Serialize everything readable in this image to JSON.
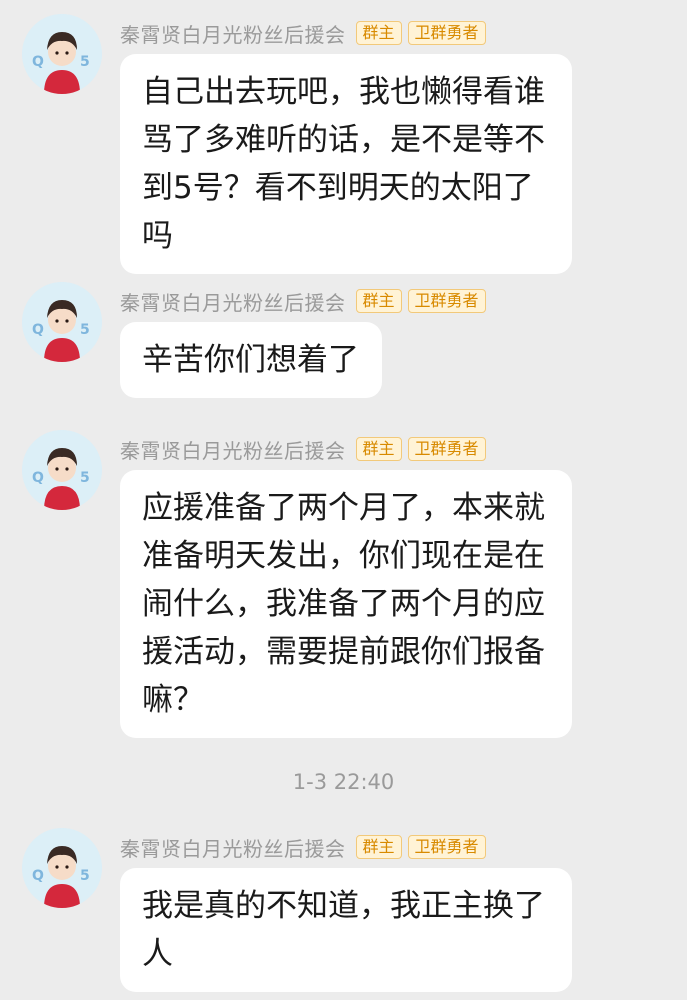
{
  "messages": [
    {
      "sender": "秦霄贤白月光粉丝后援会",
      "badges": [
        "群主",
        "卫群勇者"
      ],
      "lines": [
        "自己出去玩吧，我也懒得看谁",
        "骂了多难听的话，是不是等不",
        "到5号？看不到明天的太阳了",
        "吗"
      ]
    },
    {
      "sender": "秦霄贤白月光粉丝后援会",
      "badges": [
        "群主",
        "卫群勇者"
      ],
      "lines": [
        "辛苦你们想着了"
      ]
    },
    {
      "sender": "秦霄贤白月光粉丝后援会",
      "badges": [
        "群主",
        "卫群勇者"
      ],
      "lines": [
        "应援准备了两个月了，本来就",
        "准备明天发出，你们现在是在",
        "闹什么，我准备了两个月的应",
        "援活动，需要提前跟你们报备",
        "嘛？"
      ]
    },
    {
      "sender": "秦霄贤白月光粉丝后援会",
      "badges": [
        "群主",
        "卫群勇者"
      ],
      "lines": [
        "我是真的不知道，我正主换了",
        "人"
      ]
    }
  ],
  "timestamp": "1-3 22:40",
  "colors": {
    "background": "#ececec",
    "bubble": "#ffffff",
    "badge": "#d88a00"
  }
}
